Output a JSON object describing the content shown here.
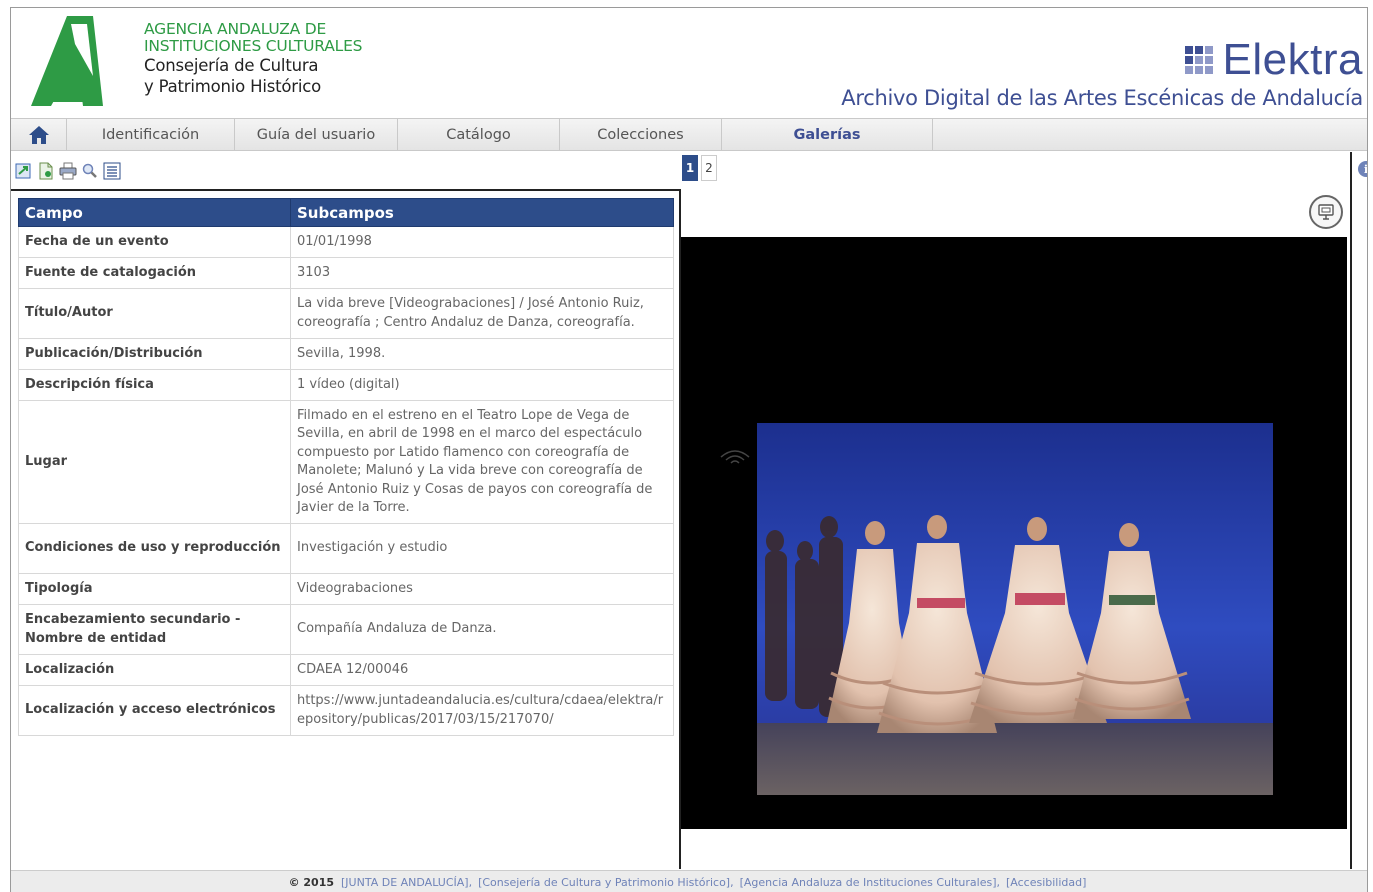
{
  "header": {
    "agency_line1": "AGENCIA ANDALUZA DE",
    "agency_line2": "INSTITUCIONES CULTURALES",
    "agency_line3": "Consejería de Cultura",
    "agency_line4": "y Patrimonio Histórico",
    "brand_name": "Elektra",
    "archive_title": "Archivo Digital de las Artes Escénicas de Andalucía",
    "colors": {
      "green": "#2e9b45",
      "brand_blue": "#3e4f93"
    }
  },
  "nav": {
    "home_icon": "home-icon",
    "items": [
      {
        "label": "Identificación"
      },
      {
        "label": "Guía del usuario"
      },
      {
        "label": "Catálogo"
      },
      {
        "label": "Colecciones"
      },
      {
        "label": "Galerías"
      }
    ]
  },
  "toolbar": {
    "icons": [
      "export-icon",
      "document-icon",
      "print-icon",
      "search-icon",
      "list-icon"
    ]
  },
  "table": {
    "headers": {
      "field": "Campo",
      "subfields": "Subcampos"
    },
    "rows": [
      {
        "field": "Fecha de un evento",
        "value": "01/01/1998"
      },
      {
        "field": "Fuente de catalogación",
        "value": "3103"
      },
      {
        "field": "Título/Autor",
        "value": "La vida breve [Videograbaciones] / José Antonio Ruiz, coreografía ; Centro Andaluz de Danza, coreografía."
      },
      {
        "field": "Publicación/Distribución",
        "value": "Sevilla, 1998."
      },
      {
        "field": "Descripción física",
        "value": "1 vídeo (digital)"
      },
      {
        "field": "Lugar",
        "value": "Filmado en el estreno en el Teatro Lope de Vega de Sevilla, en abril de 1998 en el marco del espectáculo compuesto por Latido flamenco con coreografía de Manolete; Malunó y La vida breve con coreografía de José Antonio Ruiz y Cosas de payos con coreografía de Javier de la Torre."
      },
      {
        "field": "Condiciones de uso y reproducción",
        "value": "Investigación y estudio"
      },
      {
        "field": "Tipología",
        "value": "Videograbaciones"
      },
      {
        "field": "Encabezamiento secundario - Nombre de entidad",
        "value": "Compañía Andaluza de Danza."
      },
      {
        "field": "Localización",
        "value": "CDAEA 12/00046"
      },
      {
        "field": "Localización y acceso electrónicos",
        "value": "https://www.juntadeandalucia.es/cultura/cdaea/elektra/repository/publicas/2017/03/15/217070/"
      }
    ]
  },
  "viewer": {
    "pages": [
      "1",
      "2"
    ],
    "active_page": "1",
    "fullscreen_icon": "fullscreen-icon",
    "info_icon": "i"
  },
  "footer": {
    "copyright": "© 2015",
    "links": [
      "[JUNTA DE ANDALUCÍA],",
      "[Consejería de Cultura y Patrimonio Histórico],",
      "[Agencia Andaluza de Instituciones Culturales],",
      "[Accesibilidad]"
    ]
  }
}
